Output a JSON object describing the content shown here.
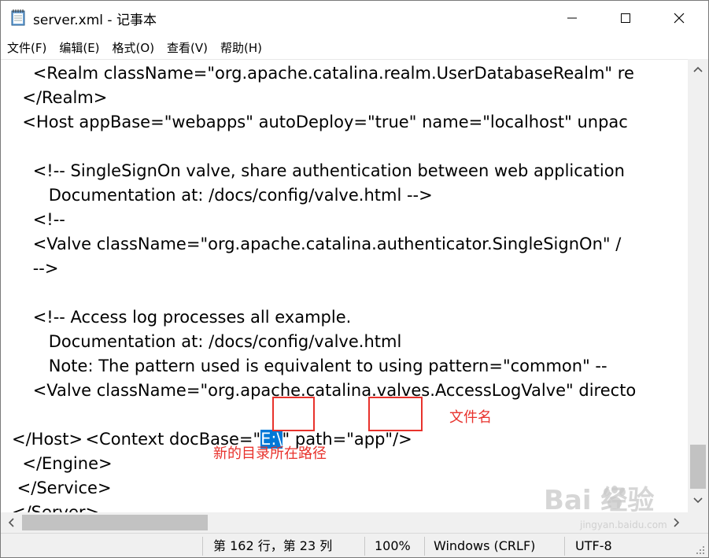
{
  "window": {
    "title": "server.xml - 记事本"
  },
  "menu": [
    "文件(F)",
    "编辑(E)",
    "格式(O)",
    "查看(V)",
    "帮助(H)"
  ],
  "editor": {
    "lines": [
      "    <Realm className=\"org.apache.catalina.realm.UserDatabaseRealm\" re",
      "  </Realm>",
      "  <Host appBase=\"webapps\" autoDeploy=\"true\" name=\"localhost\" unpac",
      "",
      "    <!-- SingleSignOn valve, share authentication between web application",
      "       Documentation at: /docs/config/valve.html -->",
      "    <!--",
      "    <Valve className=\"org.apache.catalina.authenticator.SingleSignOn\" /",
      "    -->",
      "",
      "    <!-- Access log processes all example.",
      "       Documentation at: /docs/config/valve.html",
      "       Note: The pattern used is equivalent to using pattern=\"common\" --",
      "    <Valve className=\"org.apache.catalina.valves.AccessLogValve\" directo"
    ],
    "context_line": {
      "before": "        <Context docBase=\"",
      "selected": "E:\\",
      "middle": "\" path=\"",
      "after": "app",
      "end": "\"/>"
    },
    "tail_lines": [
      "</Host>",
      "  </Engine>",
      " </Service>",
      "</Server>"
    ],
    "annotation_filename": "文件名",
    "annotation_path": "新的目录所在路径"
  },
  "status": {
    "position": "第 162 行，第 23 列",
    "zoom": "100%",
    "line_ending": "Windows (CRLF)",
    "encoding": "UTF-8"
  },
  "watermark": {
    "brand": "Bai  经验",
    "url": "jingyan.baidu.com"
  },
  "colors": {
    "selection": "#0078d7",
    "annotation_red": "#e8322c"
  }
}
